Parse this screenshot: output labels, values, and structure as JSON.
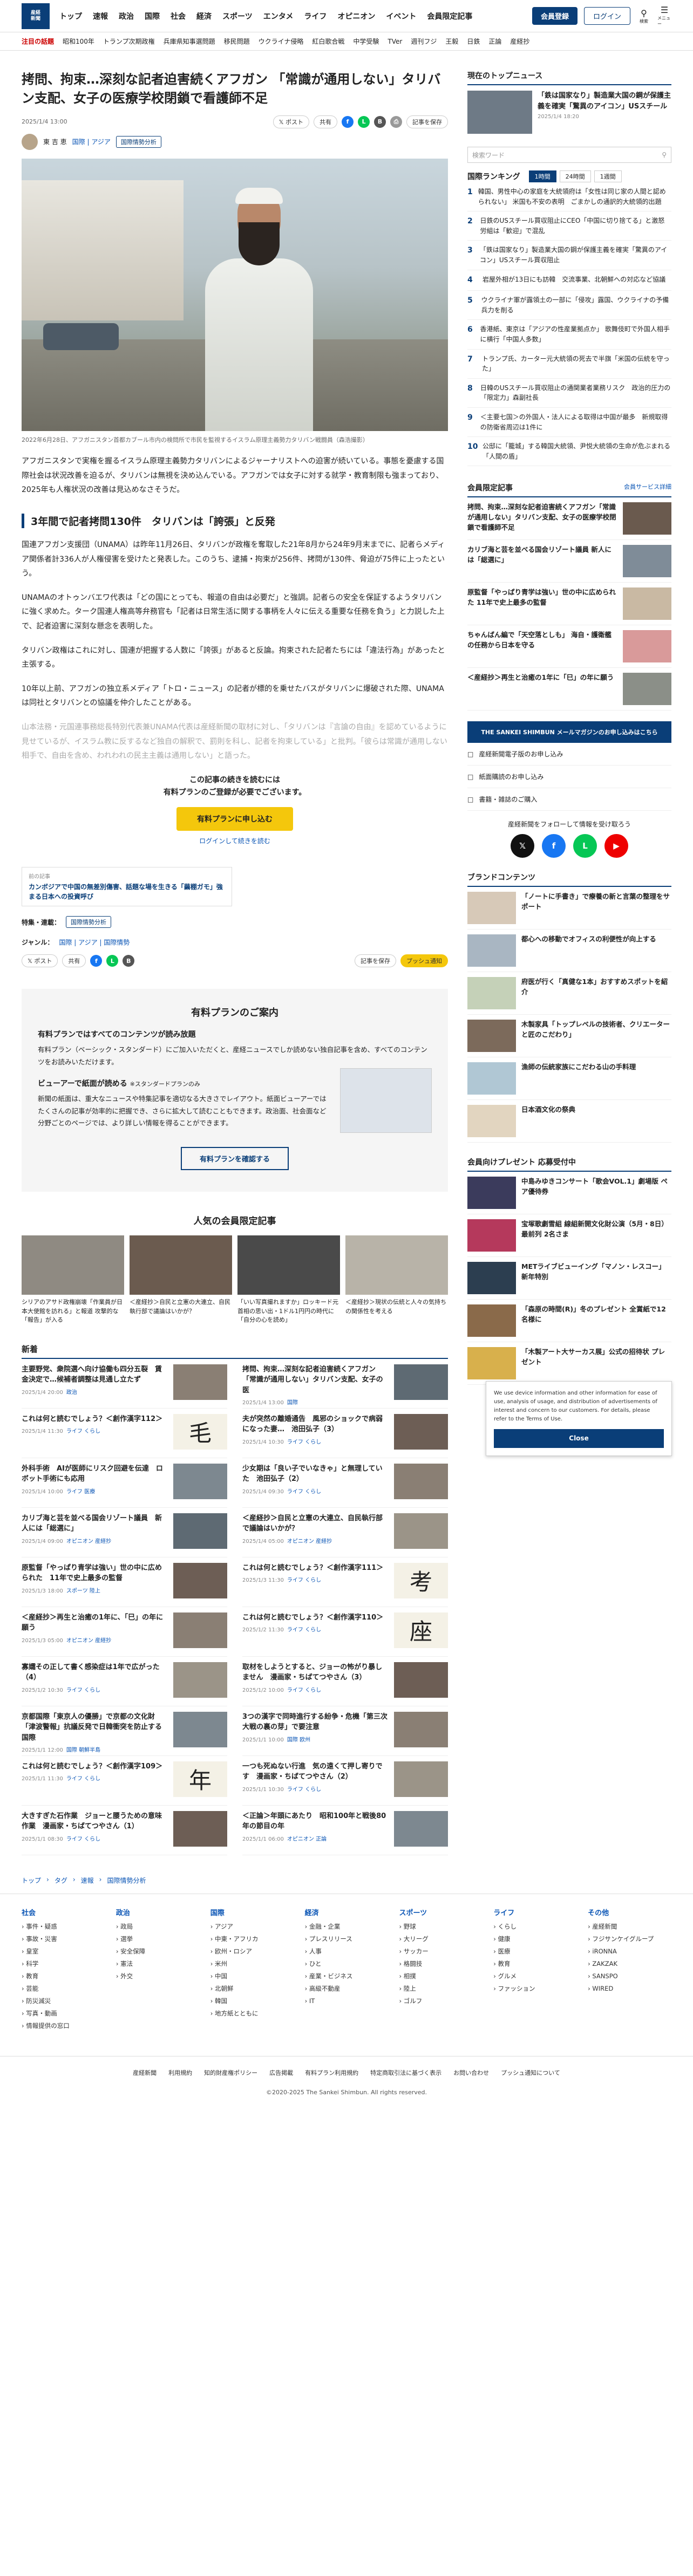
{
  "header": {
    "logo_lines": [
      "産経",
      "新聞",
      "THE SANKEI SHIMBUN"
    ],
    "nav": [
      "トップ",
      "速報",
      "政治",
      "国際",
      "社会",
      "経済",
      "スポーツ",
      "エンタメ",
      "ライフ",
      "オピニオン",
      "イベント",
      "会員限定記事"
    ],
    "member_btn": "会員登録",
    "login_btn": "ログイン",
    "search_label": "検索",
    "menu_label": "メニュー"
  },
  "subnav": {
    "label": "注目の話題",
    "items": [
      "昭和100年",
      "トランプ次期政権",
      "兵庫県知事選問題",
      "移民問題",
      "ウクライナ侵略",
      "紅白歌合戦",
      "中学受験",
      "TVer",
      "週刊フジ",
      "王毅",
      "日鉄",
      "正論",
      "産経抄"
    ]
  },
  "article": {
    "title": "拷問、拘束…深刻な記者迫害続くアフガン 「常識が通用しない」タリバン支配、女子の医療学校閉鎖で看護師不足",
    "date": "2025/1/4 13:00",
    "post_label": "ポスト",
    "share_label": "共有",
    "save_label": "記事を保存",
    "author": "東 吉 恵",
    "tags_label": "国際 | アジア",
    "tag": "国際情勢分析",
    "caption": "2022年6月28日、アフガニスタン首都カブール市内の検問所で市民を監視するイスラム原理主義勢力タリバン戦闘員（森浩撮影）",
    "lead": "アフガニスタンで実権を握るイスラム原理主義勢力タリバンによるジャーナリストへの迫害が続いている。事態を憂慮する国際社会は状況改善を迫るが、タリバンは無視を決め込んでいる。アフガンでは女子に対する就学・教育制限も強まっており、2025年も人権状況の改善は見込めなさそうだ。",
    "section_title": "3年間で記者拷問130件　タリバンは「誇張」と反発",
    "paragraphs": [
      "国連アフガン支援団（UNAMA）は昨年11月26日、タリバンが政権を奪取した21年8月から24年9月末までに、記者らメディア関係者計336人が人権侵害を受けたと発表した。このうち、逮捕・拘束が256件、拷問が130件、脅迫が75件に上ったという。",
      "UNAMAのオトゥンバエワ代表は「どの国にとっても、報道の自由は必要だ」と強調。記者らの安全を保証するようタリバンに強く求めた。ターク国連人権高等弁務官も「記者は日常生活に関する事柄を人々に伝える重要な任務を負う」と力説した上で、記者迫害に深刻な懸念を表明した。",
      "タリバン政権はこれに対し、国連が把握する人数に「誇張」があると反論。拘束された記者たちには「違法行為」があったと主張する。",
      "10年以上前、アフガンの独立系メディア「トロ・ニュース」の記者が標的を乗せたバスがタリバンに爆破された際、UNAMAは同社とタリバンとの協議を仲介したことがある。"
    ],
    "faded": "山本法務・元国連事務総長特別代表兼UNAMA代表は産経新聞の取材に対し、「タリバンは『言論の自由』を認めているように見せているが、イスラム教に反するなど独自の解釈で、罰則を科し、記者を拘束している」と批判。「彼らは常識が通用しない相手で、自由を含め、われわれの民主主義は通用しない」と語った。",
    "paywall_msg_1": "この記事の続きを読むには",
    "paywall_msg_2": "有料プランのご登録が必要でございます。",
    "paywall_btn": "有料プランに申し込む",
    "paywall_login": "ログインして続きを読む",
    "related_label": "前の記事",
    "related_title": "カンボジアで中国の無差別傷害、話題な場を生きる「繭棚ガモ」強まる日本への投資呼び",
    "special_label": "特集・連載：",
    "special_value": "国際情勢分析",
    "genre_label": "ジャンル：",
    "genre_value": "国際 | アジア | 国際情勢",
    "push_label": "プッシュ通知"
  },
  "plan": {
    "title": "有料プランのご案内",
    "h1": "有料プランではすべてのコンテンツが読み放題",
    "p1": "有料プラン（ベーシック・スタンダード）にご加入いただくと、産経ニュースでしか読めない独自記事を含め、すべてのコンテンツをお読みいただけます。",
    "h2": "ビューアーで紙面が読める",
    "h2_note": "※スタンダードプランのみ",
    "p2": "新聞の紙面は、重大なニュースや特集記事を適切なる大きさでレイアウト。紙面ビューアーではたくさんの記事が効率的に把握でき、さらに拡大して読むこともできます。政治面、社会面など分野ごとのページでは、より詳しい情報を得ることができます。",
    "btn": "有料プランを確認する"
  },
  "popular": {
    "title": "人気の会員限定記事",
    "items": [
      "シリアのアサド政権崩壊「作業員が日本大使館を訪れる」と報道 攻撃的な「報告」が入る",
      "＜産経抄＞自民と立憲の大連立、自民執行部で議論はいかが？",
      "「いい写真撮れますか」ロッキード元首相の思い出・1ドル1円円の時代に「自分の心を読め」",
      "＜産経抄＞現状の伝統と人々の気持ちの関係性を考える"
    ]
  },
  "news": {
    "title": "新着",
    "items": [
      {
        "h": "主要野党、衆院選へ向け協働も四分五裂　賃金決定で…候補者調整は見通し立たず",
        "d": "2025/1/4 20:00",
        "c": "政治",
        "k": ""
      },
      {
        "h": "拷問、拘束…深刻な記者迫害続くアフガン「常識が通用しない」タリバン支配、女子の医",
        "d": "2025/1/4 13:00",
        "c": "国際",
        "k": ""
      },
      {
        "h": "これは何と読むでしょう？＜創作漢字112＞",
        "d": "2025/1/4 11:30",
        "c": "ライフ くらし",
        "k": "毛"
      },
      {
        "h": "夫が突然の離婚通告　風邪のショックで病弱になった妻…　池田弘子（3）",
        "d": "2025/1/4 10:30",
        "c": "ライフ くらし",
        "k": ""
      },
      {
        "h": "外科手術　AIが医師にリスク回避を伝達　ロボット手術にも応用",
        "d": "2025/1/4 10:00",
        "c": "ライフ 医療",
        "k": ""
      },
      {
        "h": "少女期は「良い子でいなきゃ」と無理していた　池田弘子（2）",
        "d": "2025/1/4 09:30",
        "c": "ライフ くらし",
        "k": ""
      },
      {
        "h": "カリブ海と芸を並べる国会リゾート議員　新人には「総選に」",
        "d": "2025/1/4 09:00",
        "c": "オピニオン 産経抄",
        "k": ""
      },
      {
        "h": "＜産経抄＞自民と立憲の大連立、自民執行部で議論はいかが？",
        "d": "2025/1/4 05:00",
        "c": "オピニオン 産経抄",
        "k": ""
      },
      {
        "h": "原監督「やっぱり青学は強い」世の中に広められた　11年で史上最多の監督",
        "d": "2025/1/3 18:00",
        "c": "スポーツ 陸上",
        "k": ""
      },
      {
        "h": "これは何と読むでしょう？＜創作漢字111＞",
        "d": "2025/1/3 11:30",
        "c": "ライフ くらし",
        "k": "考"
      },
      {
        "h": "＜産経抄＞再生と治癒の1年に、「巳」の年に願う",
        "d": "2025/1/3 05:00",
        "c": "オピニオン 産経抄",
        "k": ""
      },
      {
        "h": "これは何と読むでしょう？＜創作漢字110＞",
        "d": "2025/1/2 11:30",
        "c": "ライフ くらし",
        "k": "座"
      },
      {
        "h": "寡孀その正して書く感染症は1年で広がった（4）",
        "d": "2025/1/2 10:30",
        "c": "ライフ くらし",
        "k": ""
      },
      {
        "h": "取材をしようとすると、ジョーの怖がり暴しません　漫画家・ちばてつやさん（3）",
        "d": "2025/1/2 10:00",
        "c": "ライフ くらし",
        "k": ""
      },
      {
        "h": "京都国際「東京人の優勝」で京都の文化財「津波警報」抗議反発で日韓衝突を防止する国際",
        "d": "2025/1/1 12:00",
        "c": "国際 朝鮮半島",
        "k": ""
      },
      {
        "h": "3つの漢字で同時進行する紛争・危機「第三次大戦の裏の芽」で要注意",
        "d": "2025/1/1 10:00",
        "c": "国際 欧州",
        "k": ""
      },
      {
        "h": "これは何と読むでしょう？＜創作漢字109＞",
        "d": "2025/1/1 11:30",
        "c": "ライフ くらし",
        "k": "年"
      },
      {
        "h": "一つも死ぬない行進　気の遠くて押し寄りです　漫画家・ちばてつやさん（2）",
        "d": "2025/1/1 10:30",
        "c": "ライフ くらし",
        "k": ""
      },
      {
        "h": "大きすぎた石作業　ジョーと腰うための意味作業　漫画家・ちばてつやさん（1）",
        "d": "2025/1/1 08:30",
        "c": "ライフ くらし",
        "k": ""
      },
      {
        "h": "＜正論＞年頭にあたり　昭和100年と戦後80年の節目の年",
        "d": "2025/1/1 06:00",
        "c": "オピニオン 正論",
        "k": ""
      }
    ]
  },
  "sidebar": {
    "top_title": "現在のトップニュース",
    "top_news": "「鉄は国家なり」製造業大国の鋼が保護主義を確実「驚異のアイコン」USスチール",
    "top_date": "2025/1/4 18:20",
    "search_placeholder": "検索ワード",
    "ranking_label": "国際ランキング",
    "ranking_tabs": [
      "1時間",
      "24時間",
      "1週間"
    ],
    "ranking": [
      "韓国、男性中心の家庭を大統領府は「女性は同じ家の人間と認められない」 米国も不安の表明　ごまかしの通訳的大統領的出題",
      "日鉄のUSスチール買収阻止にCEO「中国に切り捨てる」と激怒　労組は「歓迎」で混乱",
      "「鉄は国家なり」製造業大国の鋼が保護主義を確実「驚異のアイコン」USスチール買収阻止",
      "岩屋外相が13日にも訪韓　交流事業、北朝鮮への対応など協議",
      "ウクライナ軍が露領土の一部に「侵攻」露国、ウクライナの予備兵力を削る",
      "香港紙、東京は「アジアの性産業拠点か」 歌舞伎町で外国人相手に横行「中国人多数」",
      "トランプ氏、カーター元大統領の死去で半旗「米国の伝統を守った」",
      "日韓のUSスチール買収阻止の通関業者業務リスク　政治的圧力の「限定力」森副社長",
      "＜主要七国＞の外国人・法人による取得は中国が最多　新規取得の防衛省周辺は1件に",
      "公邸に「籠城」する韓国大統領、尹悦大統領の生命が危ぶまれる「人間の盾」"
    ],
    "member_title": "会員限定記事",
    "member_more": "会員サービス詳細",
    "member_items": [
      "拷問、拘束…深刻な記者迫害続くアフガン「常識が通用しない」タリバン支配、女子の医療学校閉鎖で看護師不足",
      "カリブ海と芸を並べる国会リゾート議員 新人には「総選に」",
      "原監督「やっぱり青学は強い」世の中に広められた 11年で史上最多の監督",
      "ちゃんばん編で「天空落としも」 海自・護衛艦の任務から日本を守る",
      "＜産経抄＞再生と治癒の1年に「巳」の年に願う"
    ],
    "banner": "THE SANKEI SHIMBUN  メールマガジンのお申し込みはこちら",
    "links": [
      "産経新聞電子版のお申し込み",
      "紙面購読のお申し込み",
      "書籍・雑誌のご購入"
    ],
    "follow_label": "産経新聞をフォローして情報を受け取ろう",
    "brand_title": "ブランドコンテンツ",
    "brand_items": [
      "「ノートに手書き」で療養の新と言葉の整理をサポート",
      "都心への移動でオフィスの利便性が向上する",
      "府医が行く「真健な1本」おすすめスポットを紹介",
      "木製家具「トップレベルの技術者、クリエーターと匠のこだわり」",
      "漁師の伝統家族にこだわる山の手料理",
      "日本酒文化の祭典"
    ],
    "present_title": "会員向けプレゼント 応募受付中",
    "present_items": [
      "中島みゆきコンサート「歌会VOL.1」劇場版 ペア優待券",
      "宝塚歌劇雪組 線組新開文化財公演（5月・8日）最前列 2名さま",
      "METライブビューイング「マノン・レスコー」新年特別",
      "「森原の時間(R)」冬のプレゼント 全賞紙で12名様に",
      "「木製アート大サーカス展」公式の招待状 プレゼント"
    ]
  },
  "cookie": {
    "text": "We use device information and other information for ease of use, analysis of usage, and distribution of advertisements of interest and concern to our customers. For details, please refer to the Terms of Use.",
    "close": "Close"
  },
  "bottom": {
    "breadcrumb": [
      "トップ",
      "タグ",
      "速報",
      "国際情勢分析"
    ],
    "columns": [
      {
        "hd": "社会",
        "items": [
          "事件・疑惑",
          "事故・災害",
          "皇室",
          "科学",
          "教育",
          "芸能",
          "防災減災",
          "写真・動画",
          "情報提供の窓口"
        ]
      },
      {
        "hd": "政治",
        "items": [
          "政局",
          "選挙",
          "安全保障",
          "憲法",
          "外交"
        ]
      },
      {
        "hd": "国際",
        "items": [
          "アジア",
          "中東・アフリカ",
          "欧州・ロシア",
          "米州",
          "中国",
          "北朝鮮",
          "韓国",
          "地方紙とともに"
        ]
      },
      {
        "hd": "経済",
        "items": [
          "金融・企業",
          "プレスリリース",
          "人事",
          "ひと",
          "産業・ビジネス",
          "高級不動産",
          "IT"
        ]
      },
      {
        "hd": "スポーツ",
        "items": [
          "野球",
          "大リーグ",
          "サッカー",
          "格闘技",
          "相撲",
          "陸上",
          "ゴルフ"
        ]
      },
      {
        "hd": "ライフ",
        "items": [
          "くらし",
          "健康",
          "医療",
          "教育",
          "グルメ",
          "ファッション"
        ]
      },
      {
        "hd": "その他",
        "items": [
          "産経新聞",
          "フジサンケイグループ",
          "iRONNA",
          "ZAKZAK",
          "SANSPO",
          "WIRED"
        ]
      }
    ],
    "footer_links": [
      "産経新聞",
      "利用規約",
      "知的財産権ポリシー",
      "広告掲載",
      "有料プラン利用規約",
      "特定商取引法に基づく表示",
      "お問い合わせ",
      "プッシュ通知について"
    ],
    "copyright": "©2020-2025 The Sankei Shimbun. All rights reserved."
  }
}
